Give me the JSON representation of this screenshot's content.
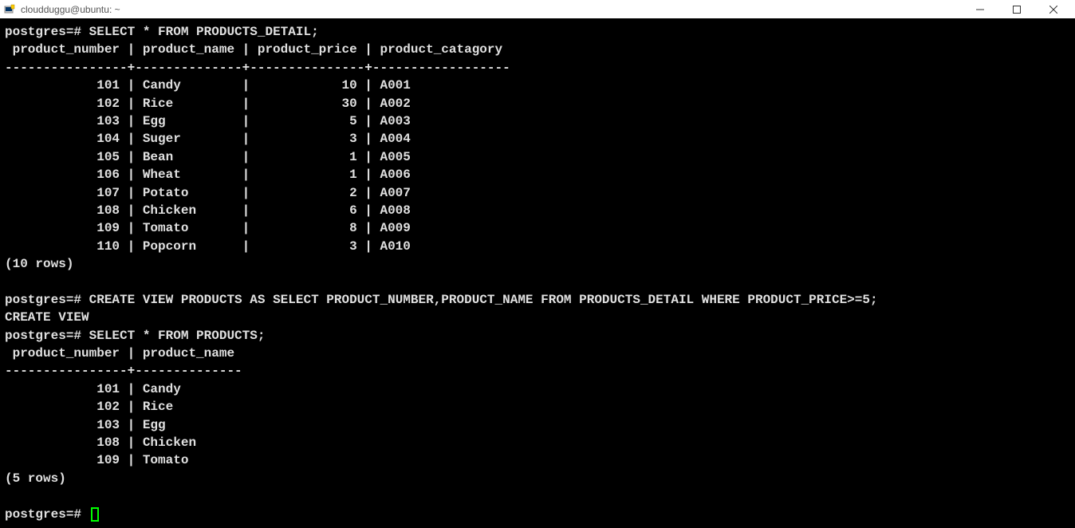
{
  "window": {
    "title": "cloudduggu@ubuntu: ~"
  },
  "terminal": {
    "prompt": "postgres=#",
    "query1": "SELECT * FROM PRODUCTS_DETAIL;",
    "query1_header": " product_number | product_name | product_price | product_catagory",
    "query1_divider": "----------------+--------------+---------------+------------------",
    "query1_rows": [
      "            101 | Candy        |            10 | A001",
      "            102 | Rice         |            30 | A002",
      "            103 | Egg          |             5 | A003",
      "            104 | Suger        |             3 | A004",
      "            105 | Bean         |             1 | A005",
      "            106 | Wheat        |             1 | A006",
      "            107 | Potato       |             2 | A007",
      "            108 | Chicken      |             6 | A008",
      "            109 | Tomato       |             8 | A009",
      "            110 | Popcorn      |             3 | A010"
    ],
    "query1_count": "(10 rows)",
    "query2": "CREATE VIEW PRODUCTS AS SELECT PRODUCT_NUMBER,PRODUCT_NAME FROM PRODUCTS_DETAIL WHERE PRODUCT_PRICE>=5;",
    "query2_result": "CREATE VIEW",
    "query3": "SELECT * FROM PRODUCTS;",
    "query3_header": " product_number | product_name",
    "query3_divider": "----------------+--------------",
    "query3_rows": [
      "            101 | Candy",
      "            102 | Rice",
      "            103 | Egg",
      "            108 | Chicken",
      "            109 | Tomato"
    ],
    "query3_count": "(5 rows)"
  }
}
